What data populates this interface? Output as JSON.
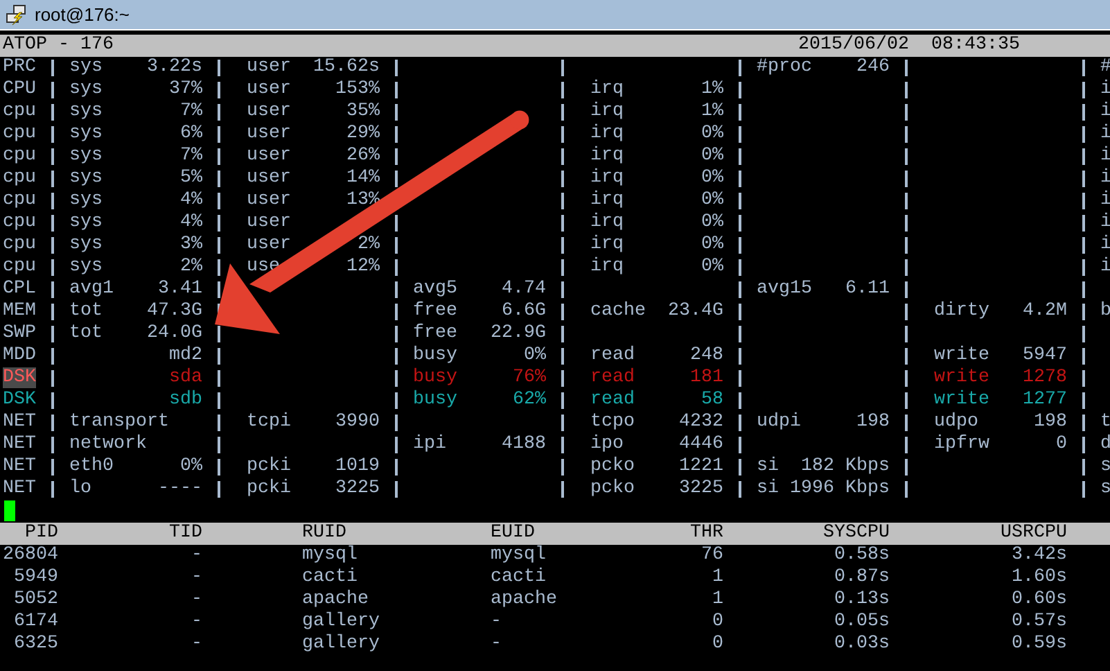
{
  "window": {
    "title": "root@176:~"
  },
  "header": {
    "title": "ATOP - 176",
    "datetime": "2015/06/02  08:43:35"
  },
  "rows": [
    {
      "label": "PRC",
      "kind": "normal",
      "cells": [
        {
          "name": "sys",
          "value": "3.22s"
        },
        {
          "name": "user",
          "value": "15.62s"
        },
        null,
        null,
        {
          "name": "#proc",
          "value": "246"
        },
        null,
        {
          "value": "#"
        }
      ]
    },
    {
      "label": "CPU",
      "kind": "normal",
      "cells": [
        {
          "name": "sys",
          "value": "37%"
        },
        {
          "name": "user",
          "value": "153%"
        },
        null,
        {
          "name": "irq",
          "value": "1%"
        },
        null,
        null,
        {
          "value": "i"
        }
      ]
    },
    {
      "label": "cpu",
      "kind": "normal",
      "cells": [
        {
          "name": "sys",
          "value": "7%"
        },
        {
          "name": "user",
          "value": "35%"
        },
        null,
        {
          "name": "irq",
          "value": "1%"
        },
        null,
        null,
        {
          "value": "i"
        }
      ]
    },
    {
      "label": "cpu",
      "kind": "normal",
      "cells": [
        {
          "name": "sys",
          "value": "6%"
        },
        {
          "name": "user",
          "value": "29%"
        },
        null,
        {
          "name": "irq",
          "value": "0%"
        },
        null,
        null,
        {
          "value": "i"
        }
      ]
    },
    {
      "label": "cpu",
      "kind": "normal",
      "cells": [
        {
          "name": "sys",
          "value": "7%"
        },
        {
          "name": "user",
          "value": "26%"
        },
        null,
        {
          "name": "irq",
          "value": "0%"
        },
        null,
        null,
        {
          "value": "i"
        }
      ]
    },
    {
      "label": "cpu",
      "kind": "normal",
      "cells": [
        {
          "name": "sys",
          "value": "5%"
        },
        {
          "name": "user",
          "value": "14%"
        },
        null,
        {
          "name": "irq",
          "value": "0%"
        },
        null,
        null,
        {
          "value": "i"
        }
      ]
    },
    {
      "label": "cpu",
      "kind": "normal",
      "cells": [
        {
          "name": "sys",
          "value": "4%"
        },
        {
          "name": "user",
          "value": "13%"
        },
        null,
        {
          "name": "irq",
          "value": "0%"
        },
        null,
        null,
        {
          "value": "i"
        }
      ]
    },
    {
      "label": "cpu",
      "kind": "normal",
      "cells": [
        {
          "name": "sys",
          "value": "4%"
        },
        {
          "name": "user"
        },
        null,
        {
          "name": "irq",
          "value": "0%"
        },
        null,
        null,
        {
          "value": "i"
        }
      ]
    },
    {
      "label": "cpu",
      "kind": "normal",
      "cells": [
        {
          "name": "sys",
          "value": "3%"
        },
        {
          "name": "user",
          "value": "2%"
        },
        null,
        {
          "name": "irq",
          "value": "0%"
        },
        null,
        null,
        {
          "value": "i"
        }
      ]
    },
    {
      "label": "cpu",
      "kind": "normal",
      "cells": [
        {
          "name": "sys",
          "value": "2%"
        },
        {
          "name": "use",
          "value": "12%"
        },
        null,
        {
          "name": "irq",
          "value": "0%"
        },
        null,
        null,
        {
          "value": "i"
        }
      ]
    },
    {
      "label": "CPL",
      "kind": "normal",
      "cells": [
        {
          "name": "avg1",
          "value": "3.41"
        },
        null,
        {
          "name": "avg5",
          "value": "4.74"
        },
        null,
        {
          "name": "avg15",
          "value": "6.11"
        },
        null,
        null
      ]
    },
    {
      "label": "MEM",
      "kind": "normal",
      "cells": [
        {
          "name": "tot",
          "value": "47.3G"
        },
        null,
        {
          "name": "free",
          "value": "6.6G"
        },
        {
          "name": "cache",
          "value": "23.4G"
        },
        null,
        {
          "name": "dirty",
          "value": "4.2M"
        },
        {
          "value": "b"
        }
      ]
    },
    {
      "label": "SWP",
      "kind": "normal",
      "cells": [
        {
          "name": "tot",
          "value": "24.0G"
        },
        null,
        {
          "name": "free",
          "value": "22.9G"
        },
        null,
        null,
        null,
        null
      ]
    },
    {
      "label": "MDD",
      "kind": "normal",
      "cells": [
        {
          "value": "md2"
        },
        null,
        {
          "name": "busy",
          "value": "0%"
        },
        {
          "name": "read",
          "value": "248"
        },
        null,
        {
          "name": "write",
          "value": "5947"
        },
        null
      ]
    },
    {
      "label": "DSK",
      "kind": "critical",
      "cells": [
        {
          "value": "sda"
        },
        null,
        {
          "name": "busy",
          "value": "76%"
        },
        {
          "name": "read",
          "value": "181"
        },
        null,
        {
          "name": "write",
          "value": "1278"
        },
        null
      ]
    },
    {
      "label": "DSK",
      "kind": "warning",
      "cells": [
        {
          "value": "sdb"
        },
        null,
        {
          "name": "busy",
          "value": "62%"
        },
        {
          "name": "read",
          "value": "58"
        },
        null,
        {
          "name": "write",
          "value": "1277"
        },
        null
      ]
    },
    {
      "label": "NET",
      "kind": "normal",
      "cells": [
        {
          "name": "transport"
        },
        {
          "name": "tcpi",
          "value": "3990"
        },
        null,
        {
          "name": "tcpo",
          "value": "4232"
        },
        {
          "name": "udpi",
          "value": "198"
        },
        {
          "name": "udpo",
          "value": "198"
        },
        {
          "value": "t"
        }
      ]
    },
    {
      "label": "NET",
      "kind": "normal",
      "cells": [
        {
          "name": "network"
        },
        null,
        {
          "name": "ipi",
          "value": "4188"
        },
        {
          "name": "ipo",
          "value": "4446"
        },
        null,
        {
          "name": "ipfrw",
          "value": "0"
        },
        {
          "value": "d"
        }
      ]
    },
    {
      "label": "NET",
      "kind": "normal",
      "cells": [
        {
          "name": "eth0",
          "value": "0%"
        },
        {
          "name": "pcki",
          "value": "1019"
        },
        null,
        {
          "name": "pcko",
          "value": "1221"
        },
        {
          "name": "si",
          "value": "182 Kbps"
        },
        null,
        {
          "value": "s"
        }
      ]
    },
    {
      "label": "NET",
      "kind": "normal",
      "cells": [
        {
          "name": "lo",
          "value": "----"
        },
        {
          "name": "pcki",
          "value": "3225"
        },
        null,
        {
          "name": "pcko",
          "value": "3225"
        },
        {
          "name": "si",
          "value": "1996 Kbps"
        },
        null,
        {
          "value": "s"
        }
      ]
    }
  ],
  "processes": {
    "columns": [
      "PID",
      "TID",
      "RUID",
      "EUID",
      "THR",
      "SYSCPU",
      "USRCPU"
    ],
    "rows": [
      [
        "26804",
        "-",
        "mysql",
        "mysql",
        "76",
        "0.58s",
        "3.42s"
      ],
      [
        "5949",
        "-",
        "cacti",
        "cacti",
        "1",
        "0.87s",
        "1.60s"
      ],
      [
        "5052",
        "-",
        "apache",
        "apache",
        "1",
        "0.13s",
        "0.60s"
      ],
      [
        "6174",
        "-",
        "gallery",
        "-",
        "0",
        "0.05s",
        "0.57s"
      ],
      [
        "6325",
        "-",
        "gallery",
        "-",
        "0",
        "0.03s",
        "0.59s"
      ]
    ]
  }
}
